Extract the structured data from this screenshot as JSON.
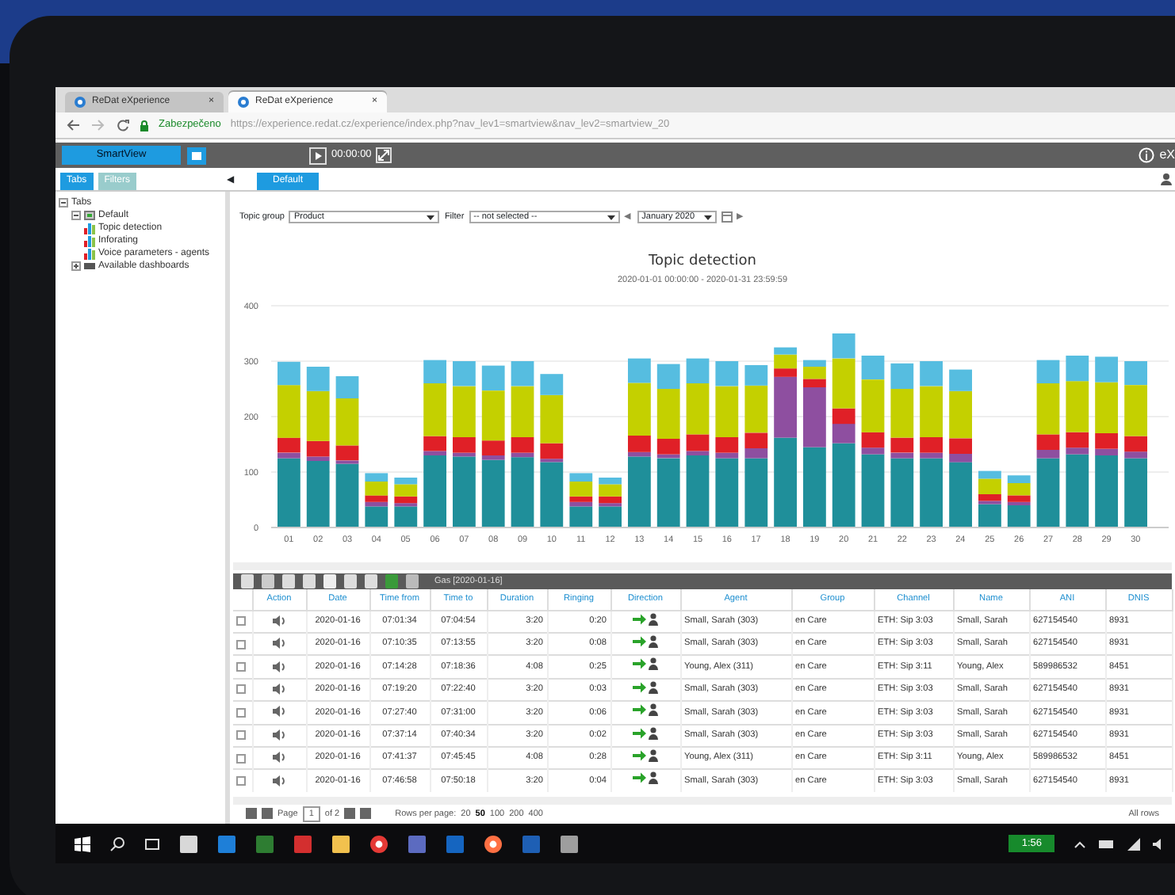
{
  "browser": {
    "tabs": [
      {
        "title": "ReDat eXperience",
        "close": "×",
        "selected": false
      },
      {
        "title": "ReDat eXperience",
        "close": "×",
        "selected": true
      }
    ],
    "security_label": "Zabezpečeno",
    "url": "https://experience.redat.cz/experience/index.php?nav_lev1=smartview&nav_lev2=smartview_20"
  },
  "app_bar": {
    "title": "SmartView",
    "time": "00:00:00",
    "brand": "eX"
  },
  "panel_tabs": [
    {
      "label": "Tabs",
      "selected": true
    },
    {
      "label": "Filters",
      "selected": false
    }
  ],
  "collapse": "◀",
  "view_tabs": [
    {
      "label": "Default",
      "selected": true
    }
  ],
  "tree": [
    {
      "label": "Tabs",
      "expanded": true,
      "children": [
        {
          "label": "Default",
          "expanded": true,
          "children": [
            {
              "label": "Topic detection"
            },
            {
              "label": "Inforating"
            },
            {
              "label": "Voice parameters - agents"
            }
          ]
        },
        {
          "label": "Available dashboards",
          "expanded": false
        }
      ]
    }
  ],
  "filters": {
    "topic_group": {
      "label": "Topic group",
      "value": "Product"
    },
    "filter": {
      "label": "Filter",
      "value": "-- not selected --"
    },
    "period": {
      "prev": "◀",
      "value": "January 2020",
      "next": "▶"
    }
  },
  "chart": {
    "title": "Topic detection",
    "subtitle": "2020-01-01 00:00:00 - 2020-01-31 23:59:59",
    "chart_data": {
      "type": "bar",
      "stacked": true,
      "grid": true,
      "categories": [
        "01",
        "02",
        "03",
        "04",
        "05",
        "06",
        "07",
        "08",
        "09",
        "10",
        "11",
        "12",
        "13",
        "14",
        "15",
        "16",
        "17",
        "18",
        "19",
        "20",
        "21",
        "22",
        "23",
        "24",
        "25",
        "26",
        "27",
        "28",
        "29",
        "30"
      ],
      "ylim": [
        0,
        400
      ],
      "yticks": [
        0,
        100,
        200,
        300,
        400
      ],
      "series": [
        {
          "color": "#1f8f9a",
          "values": [
            125,
            120,
            115,
            38,
            38,
            130,
            128,
            122,
            127,
            118,
            38,
            38,
            128,
            125,
            130,
            125,
            125,
            162,
            145,
            152,
            132,
            125,
            125,
            118,
            42,
            40,
            125,
            132,
            130,
            125
          ]
        },
        {
          "color": "#8e4fa0",
          "values": [
            10,
            8,
            6,
            8,
            6,
            8,
            7,
            8,
            8,
            6,
            8,
            6,
            8,
            7,
            8,
            10,
            18,
            110,
            108,
            35,
            12,
            10,
            10,
            15,
            6,
            6,
            15,
            12,
            12,
            12
          ]
        },
        {
          "color": "#e02027",
          "values": [
            27,
            28,
            27,
            12,
            12,
            27,
            28,
            27,
            28,
            28,
            10,
            12,
            30,
            28,
            30,
            28,
            28,
            15,
            15,
            28,
            28,
            27,
            28,
            28,
            12,
            12,
            28,
            28,
            28,
            28
          ]
        },
        {
          "color": "#c4d000",
          "values": [
            95,
            90,
            85,
            25,
            22,
            95,
            92,
            90,
            92,
            87,
            27,
            22,
            95,
            90,
            92,
            92,
            85,
            25,
            22,
            90,
            95,
            88,
            92,
            85,
            28,
            22,
            92,
            92,
            92,
            92
          ]
        },
        {
          "color": "#56bde0",
          "values": [
            42,
            44,
            40,
            15,
            12,
            42,
            45,
            45,
            45,
            38,
            15,
            12,
            44,
            45,
            45,
            45,
            37,
            13,
            12,
            45,
            43,
            46,
            45,
            39,
            14,
            14,
            42,
            46,
            46,
            43
          ]
        }
      ]
    }
  },
  "grid": {
    "toolbar_label": "Gas [2020-01-16]",
    "columns": [
      {
        "kind": "check"
      },
      {
        "label": "Action",
        "kind": "action"
      },
      {
        "label": "Date",
        "kind": "text"
      },
      {
        "label": "Time from",
        "kind": "text"
      },
      {
        "label": "Time to",
        "kind": "text"
      },
      {
        "label": "Duration",
        "kind": "num"
      },
      {
        "label": "Ringing",
        "kind": "num"
      },
      {
        "label": "Direction",
        "kind": "direction"
      },
      {
        "label": "Agent",
        "kind": "text"
      },
      {
        "label": "Group",
        "kind": "text"
      },
      {
        "label": "Channel",
        "kind": "text"
      },
      {
        "label": "Name",
        "kind": "text"
      },
      {
        "label": "ANI",
        "kind": "text"
      },
      {
        "label": "DNIS",
        "kind": "text"
      }
    ],
    "rows": [
      {
        "checked": false,
        "cells": [
          "",
          "",
          "2020-01-16",
          "07:01:34",
          "07:04:54",
          "3:20",
          "0:20",
          "",
          "Small, Sarah (303)",
          "en Care",
          "ETH: Sip 3:03",
          "Small, Sarah",
          "627154540",
          "8931"
        ]
      },
      {
        "checked": false,
        "cells": [
          "",
          "",
          "2020-01-16",
          "07:10:35",
          "07:13:55",
          "3:20",
          "0:08",
          "",
          "Small, Sarah (303)",
          "en Care",
          "ETH: Sip 3:03",
          "Small, Sarah",
          "627154540",
          "8931"
        ]
      },
      {
        "checked": false,
        "cells": [
          "",
          "",
          "2020-01-16",
          "07:14:28",
          "07:18:36",
          "4:08",
          "0:25",
          "",
          "Young, Alex (311)",
          "en Care",
          "ETH: Sip 3:11",
          "Young, Alex",
          "589986532",
          "8451"
        ]
      },
      {
        "checked": false,
        "cells": [
          "",
          "",
          "2020-01-16",
          "07:19:20",
          "07:22:40",
          "3:20",
          "0:03",
          "",
          "Small, Sarah (303)",
          "en Care",
          "ETH: Sip 3:03",
          "Small, Sarah",
          "627154540",
          "8931"
        ]
      },
      {
        "checked": false,
        "cells": [
          "",
          "",
          "2020-01-16",
          "07:27:40",
          "07:31:00",
          "3:20",
          "0:06",
          "",
          "Small, Sarah (303)",
          "en Care",
          "ETH: Sip 3:03",
          "Small, Sarah",
          "627154540",
          "8931"
        ]
      },
      {
        "checked": false,
        "cells": [
          "",
          "",
          "2020-01-16",
          "07:37:14",
          "07:40:34",
          "3:20",
          "0:02",
          "",
          "Small, Sarah (303)",
          "en Care",
          "ETH: Sip 3:03",
          "Small, Sarah",
          "627154540",
          "8931"
        ]
      },
      {
        "checked": false,
        "cells": [
          "",
          "",
          "2020-01-16",
          "07:41:37",
          "07:45:45",
          "4:08",
          "0:28",
          "",
          "Young, Alex (311)",
          "en Care",
          "ETH: Sip 3:11",
          "Young, Alex",
          "589986532",
          "8451"
        ]
      },
      {
        "checked": false,
        "cells": [
          "",
          "",
          "2020-01-16",
          "07:46:58",
          "07:50:18",
          "3:20",
          "0:04",
          "",
          "Small, Sarah (303)",
          "en Care",
          "ETH: Sip 3:03",
          "Small, Sarah",
          "627154540",
          "8931"
        ]
      }
    ],
    "pager": {
      "page_label": "Page",
      "page": "1",
      "of": "of 2",
      "rows_label": "Rows per page:",
      "options": [
        {
          "label": "20",
          "selected": false
        },
        {
          "label": "50",
          "selected": true
        },
        {
          "label": "100",
          "selected": false
        },
        {
          "label": "200",
          "selected": false
        },
        {
          "label": "400",
          "selected": false
        }
      ],
      "summary": "All rows"
    }
  },
  "taskbar": {
    "clock": "1:56"
  }
}
